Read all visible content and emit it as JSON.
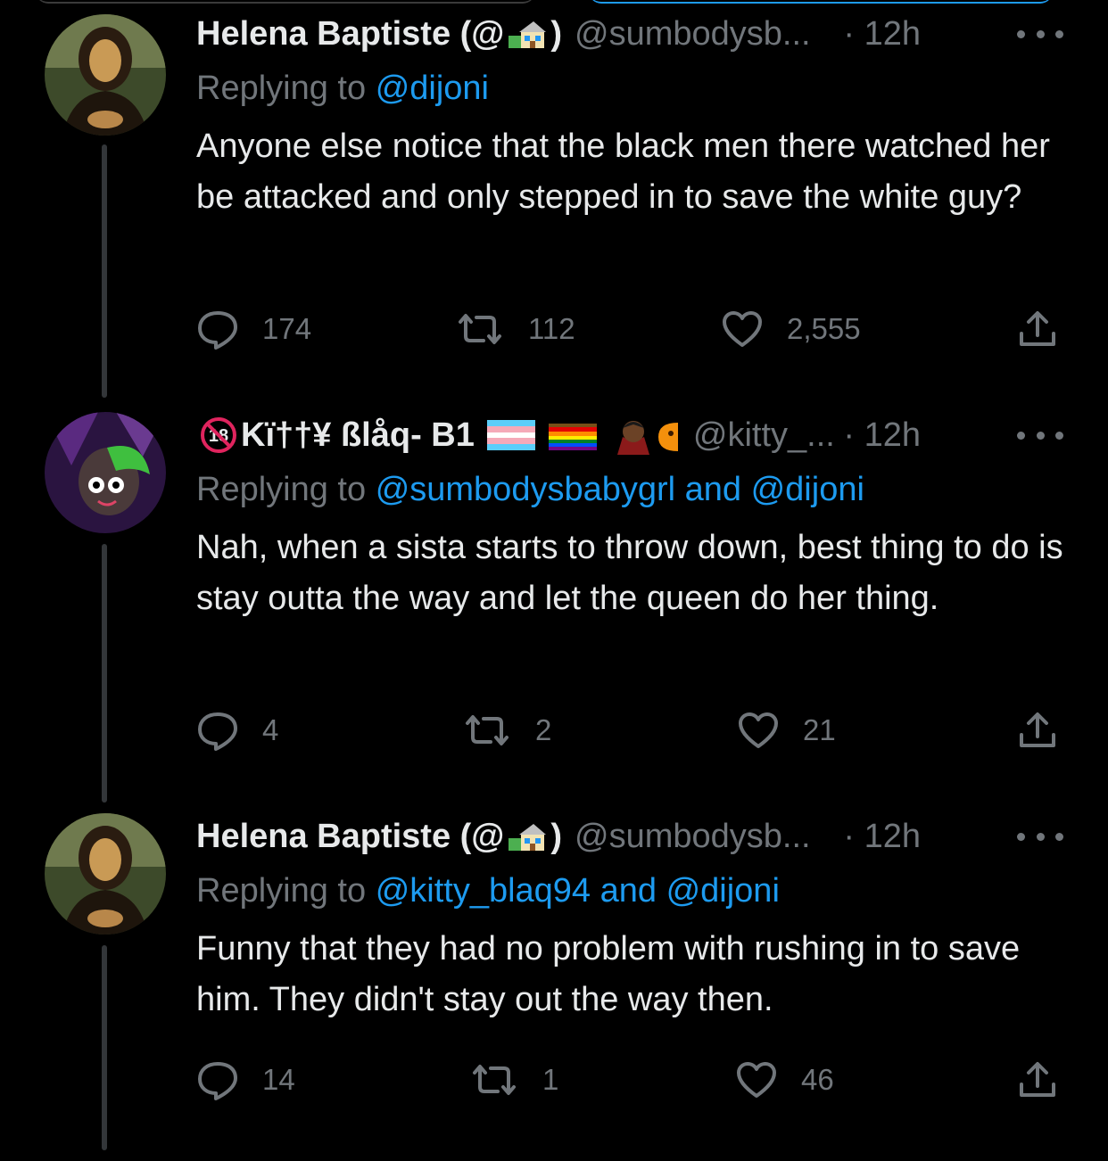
{
  "tweets": [
    {
      "display_name": "Helena Baptiste (@",
      "display_name_suffix": ")",
      "handle": "@sumbodysb...",
      "time": "· 12h",
      "replying_prefix": "Replying to",
      "replying_to": "@dijoni",
      "text": "Anyone else notice that the black men there watched her be attacked and only stepped in to save the white guy?",
      "replies": "174",
      "retweets": "112",
      "likes": "2,555"
    },
    {
      "display_name": "Kï††¥ ßlåq- B1",
      "handle": "@kitty_...",
      "time": "· 12h",
      "replying_prefix": "Replying to",
      "replying_to": "@sumbodysbabygrl and @dijoni",
      "text": "Nah, when a sista starts to throw down, best thing to do is stay outta the way and let the queen do her thing.",
      "replies": "4",
      "retweets": "2",
      "likes": "21"
    },
    {
      "display_name": "Helena Baptiste (@",
      "display_name_suffix": ")",
      "handle": "@sumbodysb...",
      "time": "· 12h",
      "replying_prefix": "Replying to",
      "replying_to": "@kitty_blaq94 and @dijoni",
      "text": "Funny that they had no problem with rushing in to save him. They didn't stay out the way then.",
      "replies": "14",
      "retweets": "1",
      "likes": "46"
    }
  ],
  "icons": {
    "reply": "reply-icon",
    "retweet": "retweet-icon",
    "like": "heart-icon",
    "share": "share-icon",
    "more": "more-icon"
  },
  "colors": {
    "background": "#000000",
    "text": "#e7e9ea",
    "muted": "#71767b",
    "link": "#1d9bf0",
    "thread": "#333639"
  }
}
